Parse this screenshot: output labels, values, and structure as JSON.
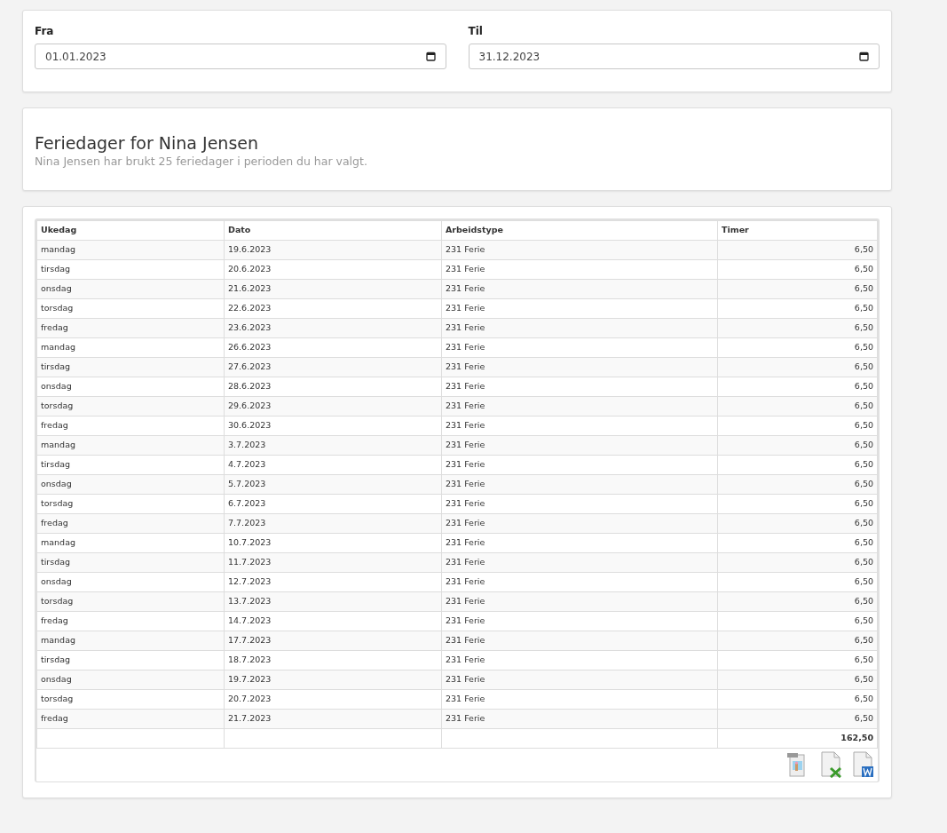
{
  "filters": [
    {
      "label": "Fra",
      "value": "01.01.2023"
    },
    {
      "label": "Til",
      "value": "31.12.2023"
    }
  ],
  "heading": {
    "title": "Feriedager for Nina Jensen",
    "subtitle": "Nina Jensen har brukt 25 feriedager i perioden du har valgt."
  },
  "table": {
    "columns": [
      "Ukedag",
      "Dato",
      "Arbeidstype",
      "Timer"
    ],
    "rows": [
      [
        "mandag",
        "19.6.2023",
        "231 Ferie",
        "6,50"
      ],
      [
        "tirsdag",
        "20.6.2023",
        "231 Ferie",
        "6,50"
      ],
      [
        "onsdag",
        "21.6.2023",
        "231 Ferie",
        "6,50"
      ],
      [
        "torsdag",
        "22.6.2023",
        "231 Ferie",
        "6,50"
      ],
      [
        "fredag",
        "23.6.2023",
        "231 Ferie",
        "6,50"
      ],
      [
        "mandag",
        "26.6.2023",
        "231 Ferie",
        "6,50"
      ],
      [
        "tirsdag",
        "27.6.2023",
        "231 Ferie",
        "6,50"
      ],
      [
        "onsdag",
        "28.6.2023",
        "231 Ferie",
        "6,50"
      ],
      [
        "torsdag",
        "29.6.2023",
        "231 Ferie",
        "6,50"
      ],
      [
        "fredag",
        "30.6.2023",
        "231 Ferie",
        "6,50"
      ],
      [
        "mandag",
        "3.7.2023",
        "231 Ferie",
        "6,50"
      ],
      [
        "tirsdag",
        "4.7.2023",
        "231 Ferie",
        "6,50"
      ],
      [
        "onsdag",
        "5.7.2023",
        "231 Ferie",
        "6,50"
      ],
      [
        "torsdag",
        "6.7.2023",
        "231 Ferie",
        "6,50"
      ],
      [
        "fredag",
        "7.7.2023",
        "231 Ferie",
        "6,50"
      ],
      [
        "mandag",
        "10.7.2023",
        "231 Ferie",
        "6,50"
      ],
      [
        "tirsdag",
        "11.7.2023",
        "231 Ferie",
        "6,50"
      ],
      [
        "onsdag",
        "12.7.2023",
        "231 Ferie",
        "6,50"
      ],
      [
        "torsdag",
        "13.7.2023",
        "231 Ferie",
        "6,50"
      ],
      [
        "fredag",
        "14.7.2023",
        "231 Ferie",
        "6,50"
      ],
      [
        "mandag",
        "17.7.2023",
        "231 Ferie",
        "6,50"
      ],
      [
        "tirsdag",
        "18.7.2023",
        "231 Ferie",
        "6,50"
      ],
      [
        "onsdag",
        "19.7.2023",
        "231 Ferie",
        "6,50"
      ],
      [
        "torsdag",
        "20.7.2023",
        "231 Ferie",
        "6,50"
      ],
      [
        "fredag",
        "21.7.2023",
        "231 Ferie",
        "6,50"
      ]
    ],
    "total": "162,50"
  },
  "exports": [
    {
      "kind": "image"
    },
    {
      "kind": "excel"
    },
    {
      "kind": "word"
    }
  ]
}
